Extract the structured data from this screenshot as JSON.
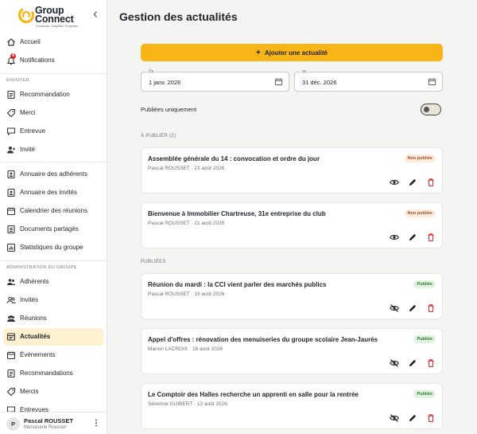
{
  "brand": {
    "name_line1": "Group",
    "name_line2": "Connect",
    "tagline": "Connecter. Simplifier. Propulser.",
    "accent_color": "#f9b515"
  },
  "sidebar": {
    "collapse_icon": "chevron-left-icon",
    "top_items": [
      {
        "label": "Accueil",
        "icon": "home-icon"
      },
      {
        "label": "Notifications",
        "icon": "bell-icon",
        "badge": "4"
      }
    ],
    "sections": [
      {
        "title": "ENVOYER",
        "items": [
          {
            "label": "Recommandation",
            "icon": "document-icon"
          },
          {
            "label": "Merci",
            "icon": "tag-icon"
          },
          {
            "label": "Entrevue",
            "icon": "chat-icon"
          },
          {
            "label": "Invité",
            "icon": "user-plus-icon"
          }
        ]
      },
      {
        "title": "",
        "items": [
          {
            "label": "Annuaire des adhérents",
            "icon": "contacts-icon"
          },
          {
            "label": "Annuaire des invités",
            "icon": "contacts-icon"
          },
          {
            "label": "Calendrier des réunions",
            "icon": "calendar-icon"
          },
          {
            "label": "Documents partagés",
            "icon": "folder-icon"
          },
          {
            "label": "Statistiques du groupe",
            "icon": "chart-icon"
          }
        ]
      },
      {
        "title": "ADMINISTRATION DU GROUPE",
        "items": [
          {
            "label": "Adhérents",
            "icon": "users-icon"
          },
          {
            "label": "Invités",
            "icon": "users-icon"
          },
          {
            "label": "Réunions",
            "icon": "users-icon"
          },
          {
            "label": "Actualités",
            "icon": "newspaper-icon",
            "active": true
          },
          {
            "label": "Événements",
            "icon": "calendar-icon"
          },
          {
            "label": "Recommandations",
            "icon": "document-icon"
          },
          {
            "label": "Mercis",
            "icon": "tag-icon"
          },
          {
            "label": "Entrevues",
            "icon": "chat-icon"
          }
        ]
      }
    ],
    "user": {
      "initial": "P",
      "name": "Pascal ROUSSET",
      "company": "Menuiserie Rousset",
      "menu_icon": "more-vertical-icon"
    }
  },
  "main": {
    "title": "Gestion des actualités",
    "add_button": "Ajouter une actualité",
    "filters": {
      "from_label": "Du",
      "from_value": "1 janv. 2026",
      "to_label": "au",
      "to_value": "31 déc. 2026",
      "published_only_label": "Publiées uniquement",
      "published_only": false
    },
    "groups": [
      {
        "title": "À PUBLIER (2)",
        "items": [
          {
            "title": "Assemblée générale du 14 : convocation et ordre du jour",
            "meta": "Pascal ROUSSET · 23 août 2026",
            "status": "Non publiée",
            "published": false
          },
          {
            "title": "Bienvenue à Immobilier Chartreuse, 31e entreprise du club",
            "meta": "Pascal ROUSSET · 21 août 2026",
            "status": "Non publiée",
            "published": false
          }
        ]
      },
      {
        "title": "PUBLIÉES",
        "items": [
          {
            "title": "Réunion du mardi : la CCI vient parler des marchés publics",
            "meta": "Pascal ROUSSET · 19 août 2026",
            "status": "Publiée",
            "published": true
          },
          {
            "title": "Appel d'offres : rénovation des menuiseries du groupe scolaire Jean-Jaurès",
            "meta": "Marion LACROIX · 16 août 2026",
            "status": "Publiée",
            "published": true
          },
          {
            "title": "Le Comptoir des Halles recherche un apprenti en salle pour la rentrée",
            "meta": "Séverine GUIBERT · 12 août 2026",
            "status": "Publiée",
            "published": true
          }
        ]
      }
    ]
  }
}
